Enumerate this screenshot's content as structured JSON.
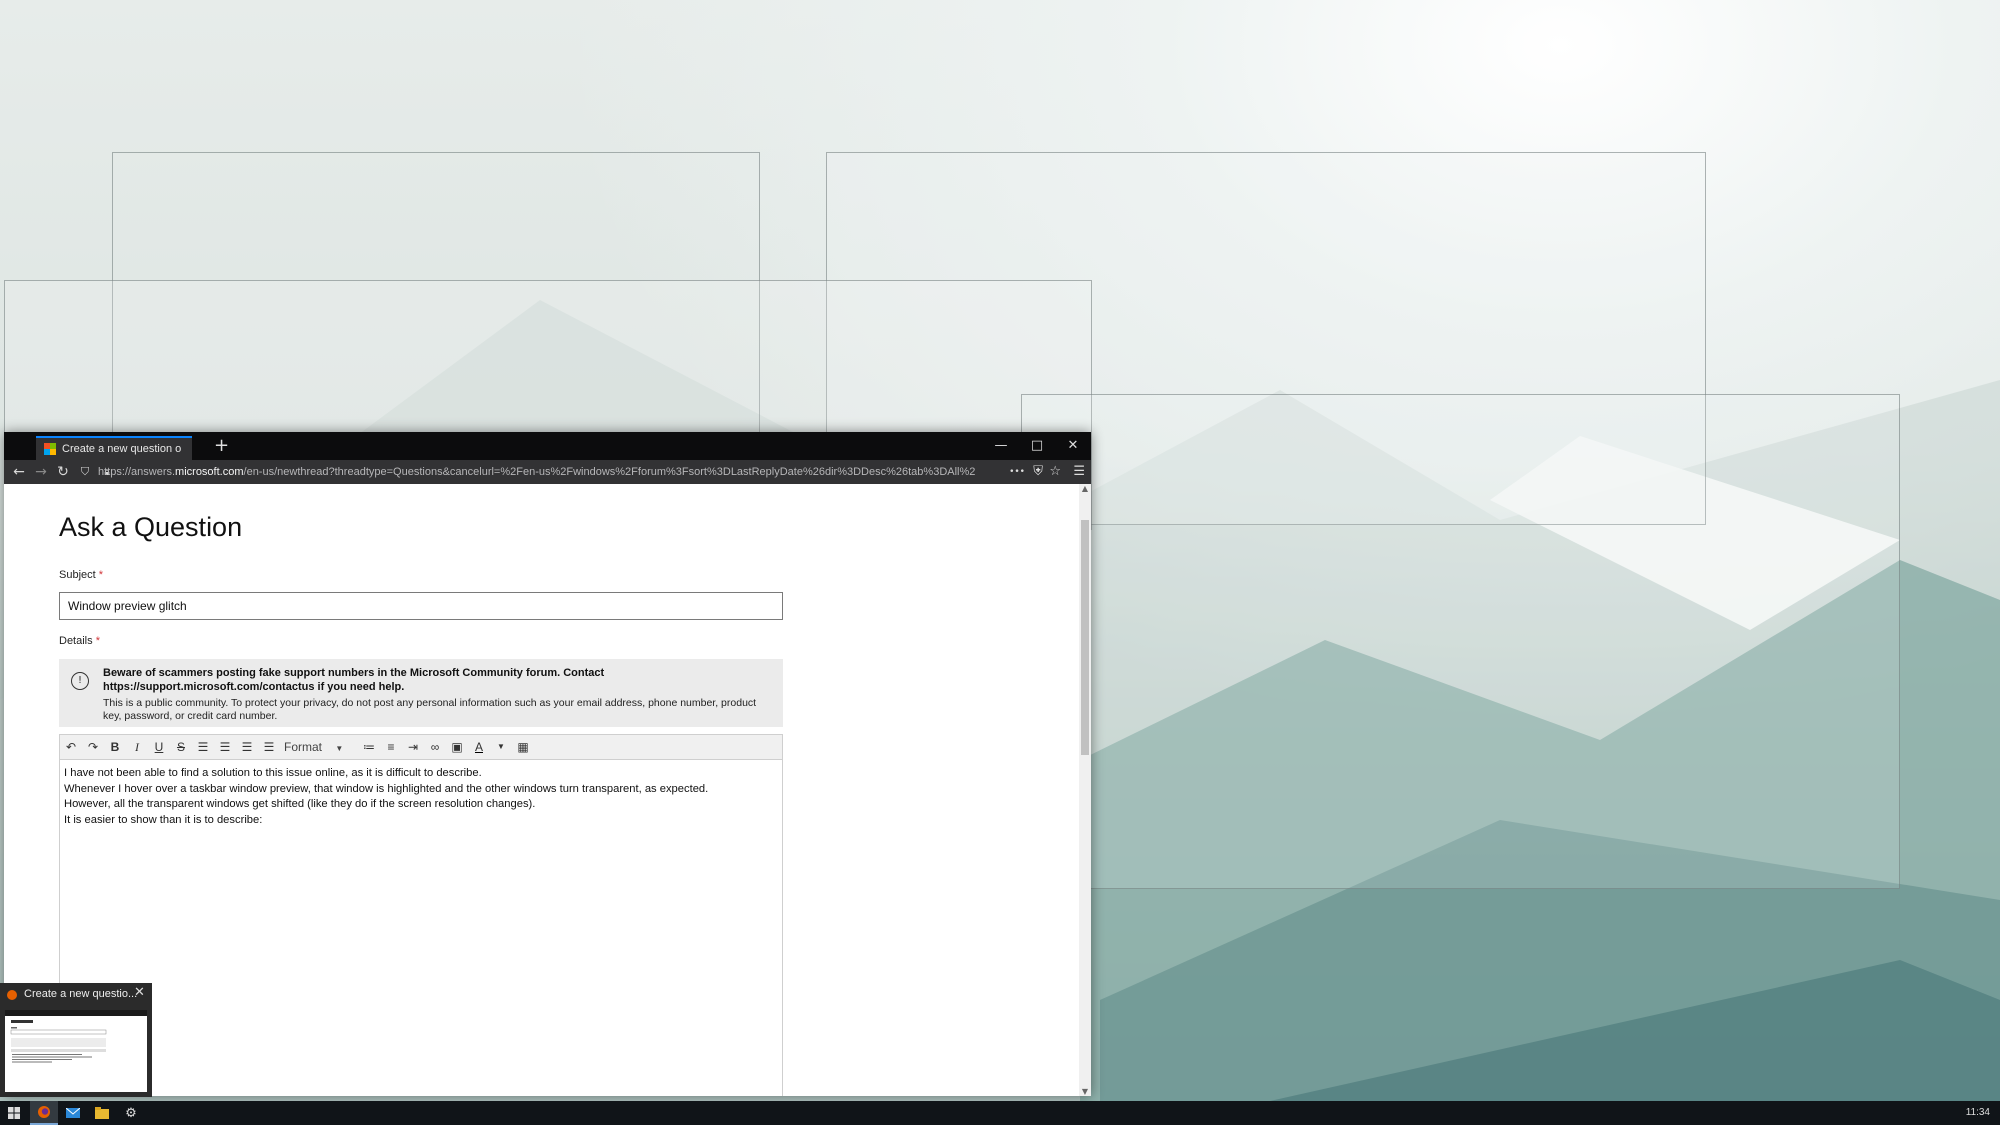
{
  "browser": {
    "tab_title": "Create a new question or start a discussion",
    "new_tab_symbol": "+",
    "url_prefix": "https://answers.",
    "url_domain": "microsoft.com",
    "url_rest": "/en-us/newthread?threadtype=Questions&cancelurl=%2Fen-us%2Fwindows%2Fforum%3Fsort%3DLastReplyDate%26dir%3DDesc%26tab%3DAll%2",
    "minimize": "—",
    "maximize": "□",
    "close": "✕",
    "more_actions": "•••"
  },
  "page": {
    "title": "Ask a Question",
    "subject_label": "Subject",
    "required_mark": "*",
    "subject_value": "Window preview glitch",
    "details_label": "Details",
    "notice_bold": "Beware of scammers posting fake support numbers in the Microsoft Community forum. Contact https://support.microsoft.com/contactus if you need help.",
    "notice_text": "This is a public community. To protect your privacy, do not post any personal information such as your email address, phone number, product key, password, or credit card number.",
    "notice_icon": "!",
    "toolbar": {
      "undo": "↶",
      "redo": "↷",
      "bold": "B",
      "italic": "I",
      "underline": "U",
      "strike": "S",
      "format": "Format"
    },
    "editor_lines": [
      "I have not been able to find a solution to this issue online, as it is difficult to describe.",
      "Whenever I hover over a taskbar window preview, that window is highlighted and the other windows turn transparent, as expected.",
      "However, all the transparent windows get shifted (like they do if the screen resolution changes).",
      "It is easier to show than it is to describe:"
    ]
  },
  "preview": {
    "title": "Create a new questio...",
    "close": "✕"
  },
  "taskbar": {
    "clock": "11:34"
  },
  "colors": {
    "accent": "#0a84ff",
    "required": "#d13438",
    "taskbar": "#101418"
  }
}
